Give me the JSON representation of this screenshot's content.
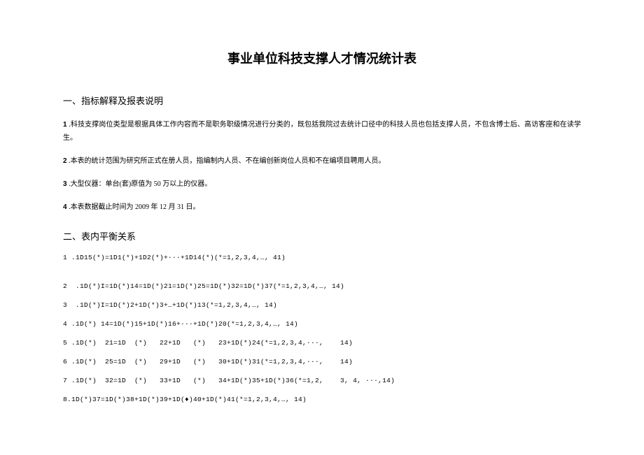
{
  "title": "事业单位科技支撑人才情况统计表",
  "section1": {
    "heading": "一、指标解释及报表说明",
    "items": [
      {
        "num": "1",
        "text": " .科技支撑岗位类型是根据具体工作内容而不是职务职级情况进行分类的，既包括我院过去统计口径中的科技人员也包括支撑人员，不包含博士后、高访客座和在读学生。"
      },
      {
        "num": "2",
        "text": " .本表的统计范围为研究所正式在册人员，指编制内人员、不在编创新岗位人员和不在编项目聘用人员。"
      },
      {
        "num": "3",
        "text": " .大型仪器：单台(套)原值为 50 万以上的仪器。"
      },
      {
        "num": "4",
        "text": " .本表数据截止时间为 2009 年 12 月 31 日。"
      }
    ]
  },
  "section2": {
    "heading": "二、表内平衡关系",
    "formulas": [
      "1 .1D15(*)=1D1(*)+1D2(*)+···+1D14(*)(*=1,2,3,4,…, 41)",
      "2  .1D(*)I=1D(*)14=1D(*)21=1D(*)25=1D(*)32=1D(*)37(*=1,2,3,4,…, 14)",
      "3  .1D(*)I=1D(*)2+1D(*)3+…+1D(*)13(*=1,2,3,4,…, 14)",
      "4 .1D(*) 14=1D(*)15+1D(*)16+···+1D(*)20(*=1,2,3,4,…, 14)",
      "5 .1D(*)  21=1D  (*)   22+1D   (*)   23+1D(*)24(*=1,2,3,4,···,    14)",
      "6 .1D(*)  25=1D  (*)   29+1D   (*)   30+1D(*)31(*=1,2,3,4,···,    14)",
      "7 .1D(*)  32=1D  (*)   33+1D   (*)   34+1D(*)35+1D(*)36(*=1,2,    3, 4, ···,14)",
      "8.1D(*)37=1D(*)38+1D(*)39+1D(♦)40+1D(*)41(*=1,2,3,4,…, 14)"
    ]
  }
}
